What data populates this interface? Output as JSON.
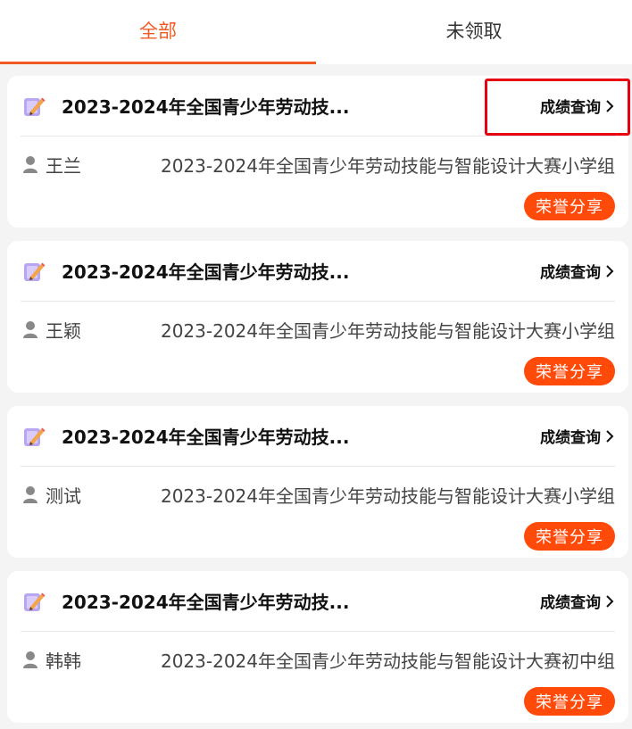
{
  "tabs": [
    {
      "label": "全部",
      "active": true
    },
    {
      "label": "未领取",
      "active": false
    }
  ],
  "accent_color": "#f05a22",
  "button_color": "#ff4a0a",
  "highlight_color": "#e60012",
  "cards": [
    {
      "icon": "trophy-pencil-icon",
      "title": "2023-2024年全国青少年劳动技...",
      "score_link": "成绩查询",
      "user": "王兰",
      "event": "2023-2024年全国青少年劳动技能与智能设计大赛小学组",
      "share_button": "荣誉分享",
      "highlighted": true
    },
    {
      "icon": "trophy-pencil-icon",
      "title": "2023-2024年全国青少年劳动技...",
      "score_link": "成绩查询",
      "user": "王颖",
      "event": "2023-2024年全国青少年劳动技能与智能设计大赛小学组",
      "share_button": "荣誉分享",
      "highlighted": false
    },
    {
      "icon": "trophy-pencil-icon",
      "title": "2023-2024年全国青少年劳动技...",
      "score_link": "成绩查询",
      "user": "测试",
      "event": "2023-2024年全国青少年劳动技能与智能设计大赛小学组",
      "share_button": "荣誉分享",
      "highlighted": false
    },
    {
      "icon": "trophy-pencil-icon",
      "title": "2023-2024年全国青少年劳动技...",
      "score_link": "成绩查询",
      "user": "韩韩",
      "event": "2023-2024年全国青少年劳动技能与智能设计大赛初中组",
      "share_button": "荣誉分享",
      "highlighted": false
    }
  ]
}
